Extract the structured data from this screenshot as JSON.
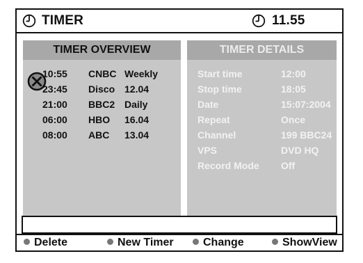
{
  "header": {
    "title": "TIMER",
    "clock_time": "11.55"
  },
  "overview": {
    "title": "TIMER OVERVIEW",
    "timers": [
      {
        "time": "10:55",
        "channel": "CNBC",
        "schedule": "Weekly"
      },
      {
        "time": "23:45",
        "channel": "Disco",
        "schedule": "12.04"
      },
      {
        "time": "21:00",
        "channel": "BBC2",
        "schedule": "Daily"
      },
      {
        "time": "06:00",
        "channel": "HBO",
        "schedule": "16.04"
      },
      {
        "time": "08:00",
        "channel": "ABC",
        "schedule": "13.04"
      }
    ]
  },
  "details": {
    "title": "TIMER DETAILS",
    "fields": [
      {
        "label": "Start time",
        "value": "12:00"
      },
      {
        "label": "Stop time",
        "value": "18:05"
      },
      {
        "label": "Date",
        "value": "15:07:2004"
      },
      {
        "label": "Repeat",
        "value": "Once"
      },
      {
        "label": "Channel",
        "value": "199 BBC24"
      },
      {
        "label": "VPS",
        "value": "DVD HQ"
      },
      {
        "label": "Record Mode",
        "value": "Off"
      }
    ]
  },
  "footer": {
    "buttons": [
      {
        "label": "Delete"
      },
      {
        "label": "New Timer"
      },
      {
        "label": "Change"
      },
      {
        "label": "ShowView"
      }
    ]
  },
  "colors": {
    "panel_bg": "#c7c7c7",
    "panel_header_bg": "#a8a8a8",
    "details_text": "#f2f2f2",
    "dot": "#777777"
  },
  "icons": {
    "clock": "clock-icon",
    "selection_cursor": "selection-cursor-icon",
    "color_key": "color-key-dot-icon"
  }
}
